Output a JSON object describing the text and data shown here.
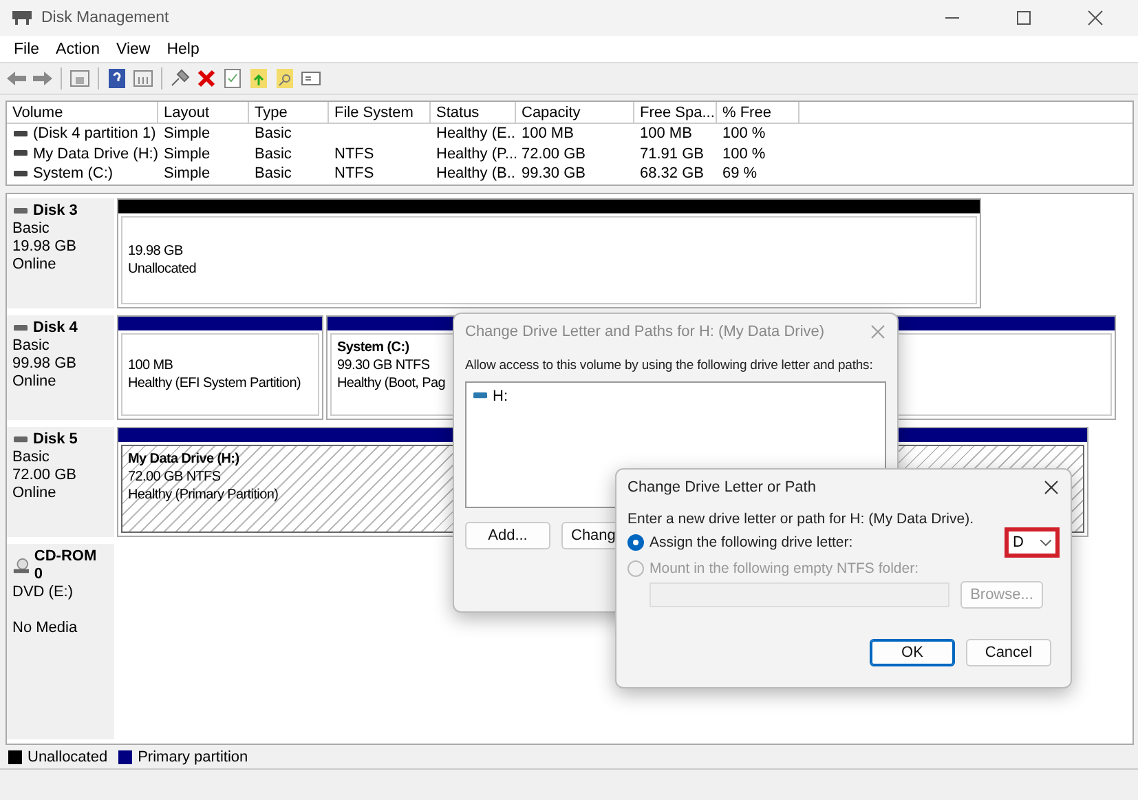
{
  "window": {
    "title": "Disk Management"
  },
  "menu": [
    {
      "label": "File"
    },
    {
      "label": "Action"
    },
    {
      "label": "View"
    },
    {
      "label": "Help"
    }
  ],
  "volume_table": {
    "columns": [
      "Volume",
      "Layout",
      "Type",
      "File System",
      "Status",
      "Capacity",
      "Free Spa...",
      "% Free"
    ],
    "rows": [
      {
        "cells": [
          "(Disk 4 partition 1)",
          "Simple",
          "Basic",
          "",
          "Healthy (E...",
          "100 MB",
          "100 MB",
          "100 %"
        ]
      },
      {
        "cells": [
          "My Data Drive (H:)",
          "Simple",
          "Basic",
          "NTFS",
          "Healthy (P...",
          "72.00 GB",
          "71.91 GB",
          "100 %"
        ]
      },
      {
        "cells": [
          "System (C:)",
          "Simple",
          "Basic",
          "NTFS",
          "Healthy (B...",
          "99.30 GB",
          "68.32 GB",
          "69 %"
        ]
      }
    ]
  },
  "disks": [
    {
      "kind": "disk",
      "name": "Disk 3",
      "type": "Basic",
      "size": "19.98 GB",
      "status": "Online",
      "partitions": [
        {
          "kind": "unallocated",
          "selected": false,
          "lines": [
            "19.98 GB",
            "Unallocated"
          ]
        }
      ]
    },
    {
      "kind": "disk",
      "name": "Disk 4",
      "type": "Basic",
      "size": "99.98 GB",
      "status": "Online",
      "partitions": [
        {
          "kind": "primary",
          "selected": false,
          "lines": [
            "100 MB",
            "Healthy (EFI System Partition)"
          ]
        },
        {
          "kind": "primary",
          "selected": false,
          "title": "System  (C:)",
          "lines": [
            "99.30 GB NTFS",
            "Healthy (Boot, Pag"
          ]
        }
      ]
    },
    {
      "kind": "disk",
      "name": "Disk 5",
      "type": "Basic",
      "size": "72.00 GB",
      "status": "Online",
      "partitions": [
        {
          "kind": "primary",
          "selected": true,
          "title": "My Data Drive  (H:)",
          "lines": [
            "72.00 GB NTFS",
            "Healthy (Primary Partition)"
          ]
        }
      ]
    },
    {
      "kind": "cdrom",
      "name": "CD-ROM 0",
      "type": "DVD (E:)",
      "status": "No Media"
    }
  ],
  "legend": [
    {
      "label": "Unallocated",
      "color": "#000000"
    },
    {
      "label": "Primary partition",
      "color": "#000080"
    }
  ],
  "paths_dialog": {
    "title": "Change Drive Letter and Paths for H: (My Data Drive)",
    "prompt": "Allow access to this volume by using the following drive letter and paths:",
    "entries": [
      "H:"
    ],
    "buttons": [
      "Add...",
      "Chang"
    ]
  },
  "letter_dialog": {
    "title": "Change Drive Letter or Path",
    "prompt": "Enter a new drive letter or path for H: (My Data Drive).",
    "options": [
      {
        "label": "Assign the following drive letter:",
        "selected": true,
        "disabled": false
      },
      {
        "label": "Mount in the following empty NTFS folder:",
        "selected": false,
        "disabled": true
      }
    ],
    "letter": {
      "value": "D",
      "highlighted": true
    },
    "browse": {
      "label": "Browse...",
      "disabled": true
    },
    "buttons": [
      {
        "label": "OK",
        "default": true
      },
      {
        "label": "Cancel",
        "default": false
      }
    ]
  }
}
